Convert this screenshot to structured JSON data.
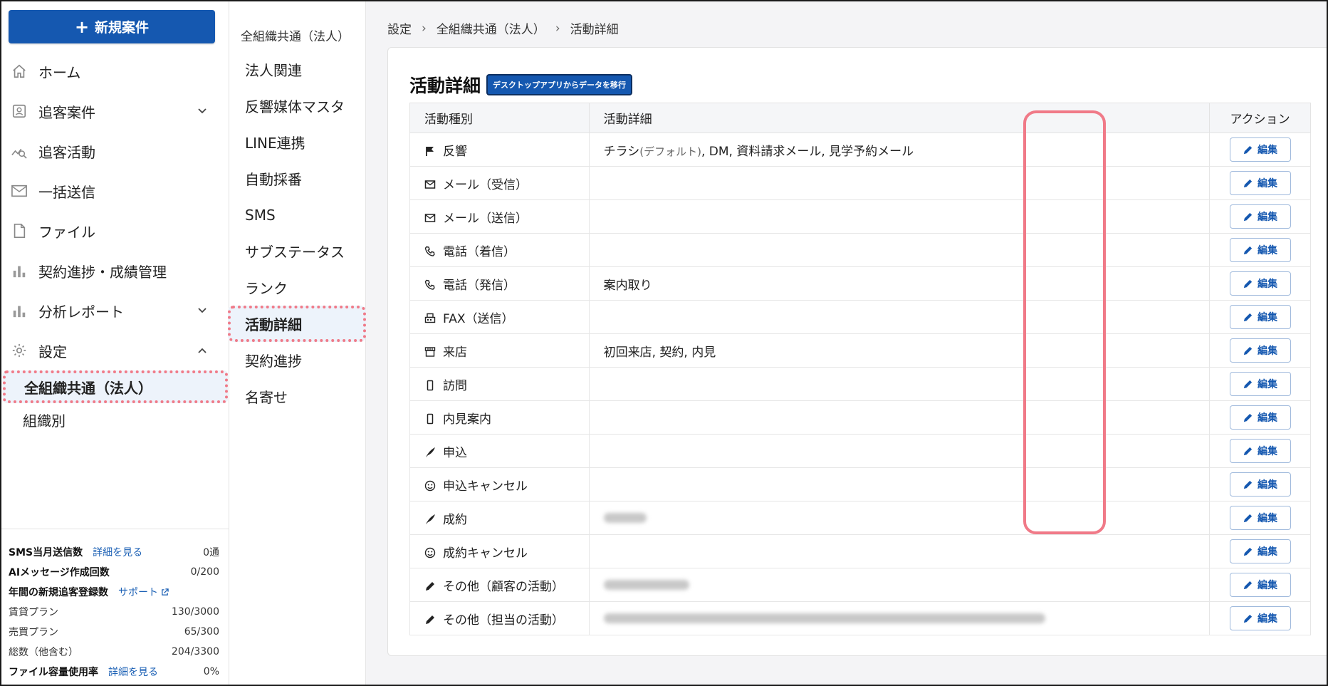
{
  "sidebar": {
    "new_button": "新規案件",
    "nav": [
      {
        "label": "ホーム",
        "icon": "home-icon"
      },
      {
        "label": "追客案件",
        "icon": "contact-icon",
        "chevron": "down"
      },
      {
        "label": "追客活動",
        "icon": "activity-icon"
      },
      {
        "label": "一括送信",
        "icon": "mail-icon"
      },
      {
        "label": "ファイル",
        "icon": "file-icon"
      },
      {
        "label": "契約進捗・成績管理",
        "icon": "bar-chart-icon"
      },
      {
        "label": "分析レポート",
        "icon": "bar-chart-icon",
        "chevron": "down"
      },
      {
        "label": "設定",
        "icon": "gear-icon",
        "chevron": "up"
      }
    ],
    "settings_sub": [
      {
        "label": "全組織共通（法人）",
        "active": true
      },
      {
        "label": "組織別",
        "active": false
      }
    ],
    "footer": {
      "sms_label": "SMS当月送信数",
      "sms_link": "詳細を見る",
      "sms_value": "0通",
      "ai_label": "AIメッセージ作成回数",
      "ai_value": "0/200",
      "annual_label": "年間の新規追客登録数",
      "annual_link": "サポート",
      "rent_label": "賃貸プラン",
      "rent_value": "130/3000",
      "sale_label": "売買プラン",
      "sale_value": "65/300",
      "total_label": "総数（他含む）",
      "total_value": "204/3300",
      "file_label": "ファイル容量使用率",
      "file_link": "詳細を見る",
      "file_value": "0%"
    }
  },
  "col2": {
    "heading": "全組織共通（法人）",
    "items": [
      {
        "label": "法人関連",
        "active": false
      },
      {
        "label": "反響媒体マスタ",
        "active": false
      },
      {
        "label": "LINE連携",
        "active": false
      },
      {
        "label": "自動採番",
        "active": false
      },
      {
        "label": "SMS",
        "active": false
      },
      {
        "label": "サブステータス",
        "active": false
      },
      {
        "label": "ランク",
        "active": false
      },
      {
        "label": "活動詳細",
        "active": true
      },
      {
        "label": "契約進捗",
        "active": false
      },
      {
        "label": "名寄せ",
        "active": false
      }
    ]
  },
  "breadcrumb": [
    "設定",
    "全組織共通（法人）",
    "活動詳細"
  ],
  "page": {
    "title": "活動詳細",
    "badge": "デスクトップアプリからデータを移行"
  },
  "table": {
    "headers": [
      "活動種別",
      "活動詳細",
      "アクション"
    ],
    "edit_label": "編集",
    "rows": [
      {
        "type": "反響",
        "icon": "flag-icon",
        "detail_pre": "チラシ",
        "detail_default": "(デフォルト)",
        "detail_post": ", DM, 資料請求メール, 見学予約メール"
      },
      {
        "type": "メール（受信）",
        "icon": "mail-icon",
        "detail_pre": ""
      },
      {
        "type": "メール（送信）",
        "icon": "mail-icon",
        "detail_pre": ""
      },
      {
        "type": "電話（着信）",
        "icon": "phone-icon",
        "detail_pre": ""
      },
      {
        "type": "電話（発信）",
        "icon": "phone-icon",
        "detail_pre": "案内取り"
      },
      {
        "type": "FAX（送信）",
        "icon": "fax-icon",
        "detail_pre": ""
      },
      {
        "type": "来店",
        "icon": "store-icon",
        "detail_pre": "初回来店, 契約, 内見"
      },
      {
        "type": "訪問",
        "icon": "mobile-icon",
        "detail_pre": ""
      },
      {
        "type": "内見案内",
        "icon": "mobile-icon",
        "detail_pre": ""
      },
      {
        "type": "申込",
        "icon": "quill-icon",
        "detail_pre": ""
      },
      {
        "type": "申込キャンセル",
        "icon": "smiley-icon",
        "detail_pre": ""
      },
      {
        "type": "成約",
        "icon": "quill-icon",
        "detail_pre": "",
        "blurred": 60
      },
      {
        "type": "成約キャンセル",
        "icon": "smiley-icon",
        "detail_pre": ""
      },
      {
        "type": "その他（顧客の活動）",
        "icon": "pencil-icon",
        "detail_pre": "",
        "blurred": 120
      },
      {
        "type": "その他（担当の活動）",
        "icon": "pencil-icon",
        "detail_pre": "",
        "blurred": 620
      }
    ]
  }
}
